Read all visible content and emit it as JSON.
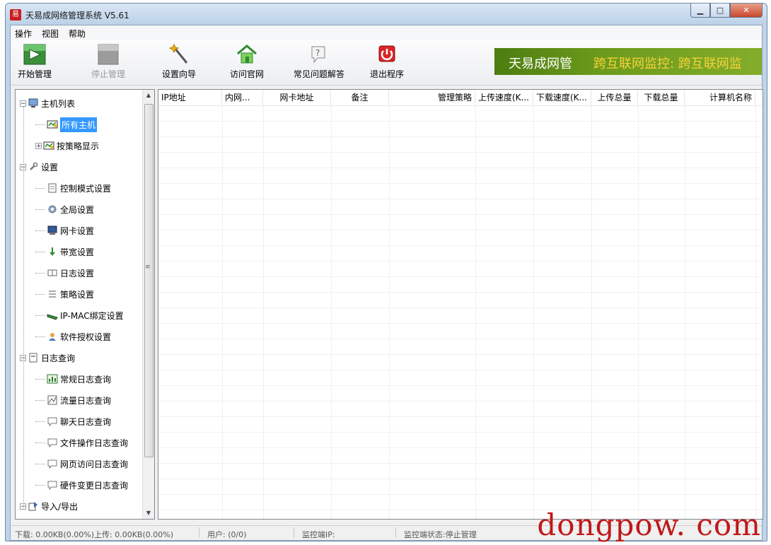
{
  "window": {
    "title": "天易成网络管理系统 V5.61",
    "app_icon_glyph": "易"
  },
  "menu": [
    "操作",
    "视图",
    "帮助"
  ],
  "toolbar": [
    {
      "label": "开始管理",
      "icon": "start-manage-icon",
      "enabled": true
    },
    {
      "label": "停止管理",
      "icon": "stop-manage-icon",
      "enabled": false
    },
    {
      "label": "设置向导",
      "icon": "wizard-wand-icon",
      "enabled": true
    },
    {
      "label": "访问官网",
      "icon": "home-icon",
      "enabled": true
    },
    {
      "label": "常见问题解答",
      "icon": "faq-icon",
      "enabled": true
    },
    {
      "label": "退出程序",
      "icon": "power-icon",
      "enabled": true
    }
  ],
  "banner": {
    "text_a": "天易成网管",
    "text_b": "跨互联网监控: 跨互联网监"
  },
  "tree": [
    {
      "label": "主机列表",
      "level": 0,
      "expander": "minus",
      "icon": "computer-icon"
    },
    {
      "label": "所有主机",
      "level": 1,
      "icon": "hosts-icon",
      "selected": true
    },
    {
      "label": "按策略显示",
      "level": 1,
      "expander": "plus",
      "icon": "hosts-icon"
    },
    {
      "label": "设置",
      "level": 0,
      "expander": "minus",
      "icon": "wrench-icon"
    },
    {
      "label": "控制模式设置",
      "level": 1,
      "icon": "document-icon"
    },
    {
      "label": "全局设置",
      "level": 1,
      "icon": "gear-icon"
    },
    {
      "label": "网卡设置",
      "level": 1,
      "icon": "monitor-icon"
    },
    {
      "label": "带宽设置",
      "level": 1,
      "icon": "down-arrow-icon"
    },
    {
      "label": "日志设置",
      "level": 1,
      "icon": "book-icon"
    },
    {
      "label": "策略设置",
      "level": 1,
      "icon": "list-icon"
    },
    {
      "label": "IP-MAC绑定设置",
      "level": 1,
      "icon": "network-card-icon"
    },
    {
      "label": "软件授权设置",
      "level": 1,
      "icon": "users-icon"
    },
    {
      "label": "日志查询",
      "level": 0,
      "expander": "minus",
      "icon": "log-icon"
    },
    {
      "label": "常规日志查询",
      "level": 1,
      "icon": "log-chart-icon"
    },
    {
      "label": "流量日志查询",
      "level": 1,
      "icon": "traffic-icon"
    },
    {
      "label": "聊天日志查询",
      "level": 1,
      "icon": "chat-bubble-icon"
    },
    {
      "label": "文件操作日志查询",
      "level": 1,
      "icon": "chat-bubble-icon"
    },
    {
      "label": "网页访问日志查询",
      "level": 1,
      "icon": "chat-bubble-icon"
    },
    {
      "label": "硬件变更日志查询",
      "level": 1,
      "icon": "chat-bubble-icon"
    },
    {
      "label": "导入/导出",
      "level": 0,
      "expander": "minus",
      "icon": "import-export-icon"
    }
  ],
  "columns": [
    "IP地址",
    "内网...",
    "网卡地址",
    "备注",
    "管理策略",
    "上传速度(K...",
    "下载速度(K...",
    "上传总量",
    "下载总量",
    "计算机名称"
  ],
  "status": {
    "download": "下载: 0.00KB(0.00%)",
    "upload": "上传: 0.00KB(0.00%)",
    "users": "用户: (0/0)",
    "monitor_ip": "监控端IP:",
    "monitor_state": "监控端状态:停止管理"
  },
  "watermark": "dongpow. com"
}
